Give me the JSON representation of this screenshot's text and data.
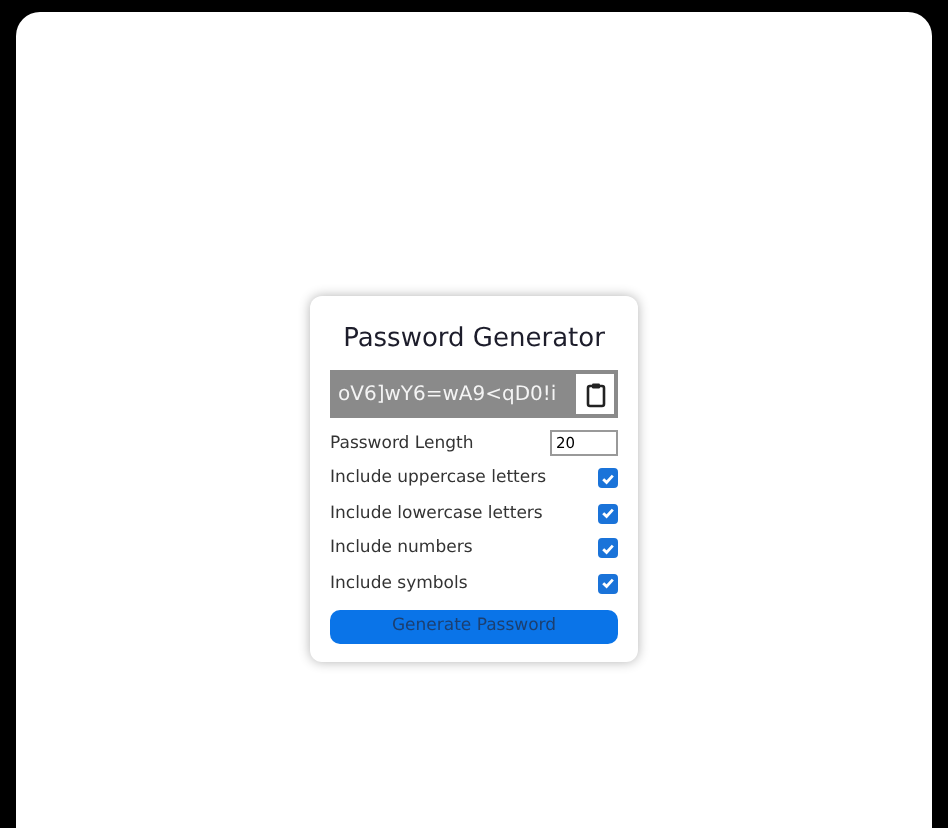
{
  "title": "Password Generator",
  "password": "oV6]wY6=wA9<qD0!i",
  "options": [
    {
      "kind": "number",
      "label": "Password Length",
      "value": "20"
    },
    {
      "kind": "checkbox",
      "label": "Include uppercase letters",
      "checked": true
    },
    {
      "kind": "checkbox",
      "label": "Include lowercase letters",
      "checked": true
    },
    {
      "kind": "checkbox",
      "label": "Include numbers",
      "checked": true
    },
    {
      "kind": "checkbox",
      "label": "Include symbols",
      "checked": true
    }
  ],
  "button": "Generate Password"
}
